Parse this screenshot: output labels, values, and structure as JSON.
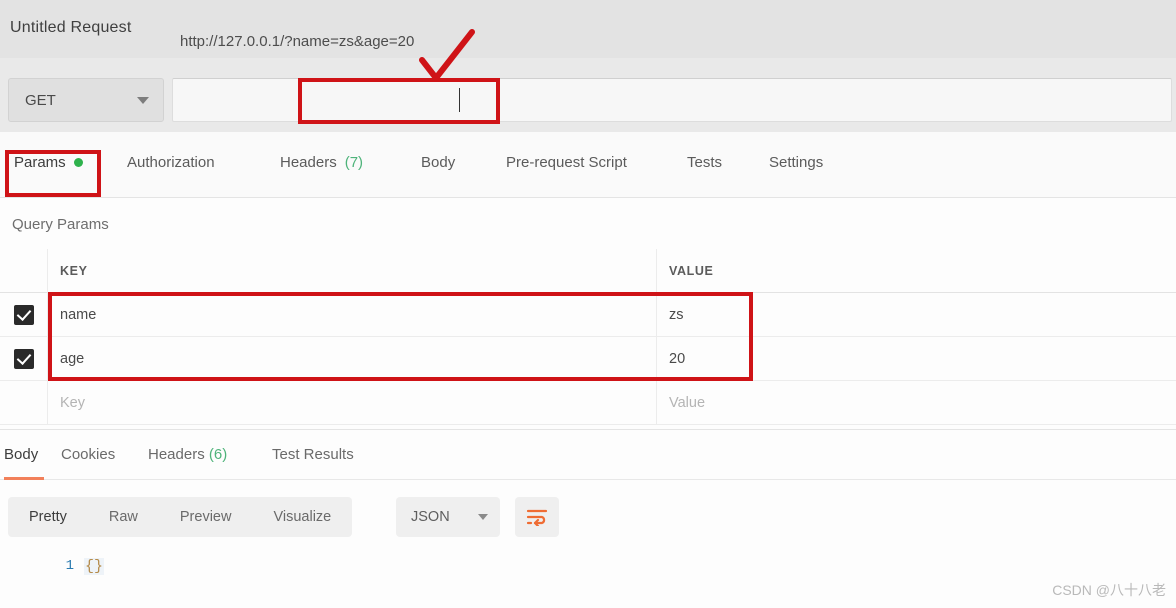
{
  "app": {
    "request_title": "Untitled Request",
    "watermark": "CSDN @八十八老"
  },
  "url_bar": {
    "method": "GET",
    "url": "http://127.0.0.1/?name=zs&age=20"
  },
  "request_tabs": [
    {
      "label": "Params",
      "badge": "",
      "active": true,
      "dot": true
    },
    {
      "label": "Authorization",
      "badge": "",
      "active": false,
      "dot": false
    },
    {
      "label": "Headers",
      "badge": "(7)",
      "active": false,
      "dot": false
    },
    {
      "label": "Body",
      "badge": "",
      "active": false,
      "dot": false
    },
    {
      "label": "Pre-request Script",
      "badge": "",
      "active": false,
      "dot": false
    },
    {
      "label": "Tests",
      "badge": "",
      "active": false,
      "dot": false
    },
    {
      "label": "Settings",
      "badge": "",
      "active": false,
      "dot": false
    }
  ],
  "query_params": {
    "section_title": "Query Params",
    "columns": {
      "key": "KEY",
      "value": "VALUE"
    },
    "rows": [
      {
        "checked": true,
        "key": "name",
        "value": "zs"
      },
      {
        "checked": true,
        "key": "age",
        "value": "20"
      }
    ],
    "placeholder_row": {
      "key": "Key",
      "value": "Value"
    }
  },
  "response_tabs": [
    {
      "label": "Body",
      "badge": "",
      "active": true
    },
    {
      "label": "Cookies",
      "badge": "",
      "active": false
    },
    {
      "label": "Headers",
      "badge": "(6)",
      "active": false
    },
    {
      "label": "Test Results",
      "badge": "",
      "active": false
    }
  ],
  "viewer_toolbar": {
    "modes": [
      {
        "label": "Pretty",
        "active": true
      },
      {
        "label": "Raw",
        "active": false
      },
      {
        "label": "Preview",
        "active": false
      },
      {
        "label": "Visualize",
        "active": false
      }
    ],
    "format": "JSON",
    "wrap_icon": "wrap-lines-icon"
  },
  "response_body": {
    "line_number": "1",
    "content": "{}"
  },
  "colors": {
    "accent_orange": "#f2805a",
    "green_dot": "#2eb24c",
    "badge_green": "#4eb37a",
    "annotation_red": "#cf1317"
  }
}
